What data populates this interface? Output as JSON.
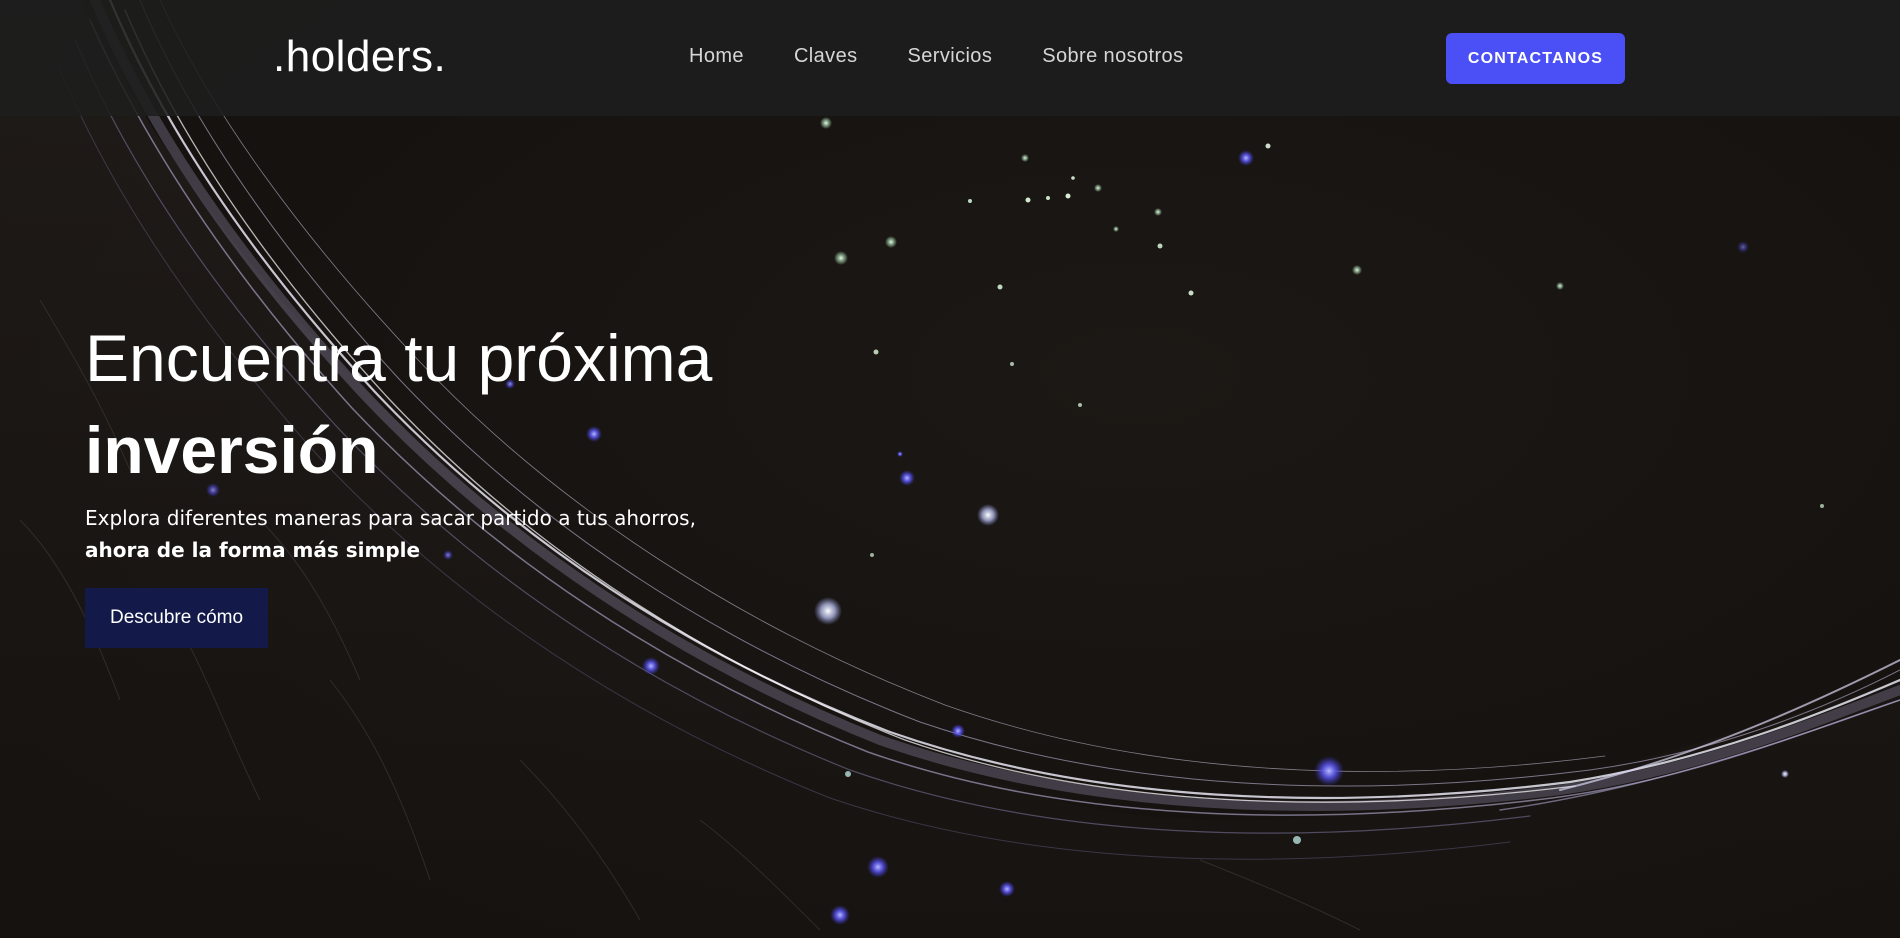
{
  "nav": {
    "logo": ".holders.",
    "links": [
      "Home",
      "Claves",
      "Servicios",
      "Sobre nosotros"
    ],
    "cta": "CONTACTANOS"
  },
  "hero": {
    "title_line1": "Encuentra tu próxima",
    "title_line2": "inversión",
    "subtitle_line1": "Explora diferentes maneras para sacar partido a tus ahorros,",
    "subtitle_line2": "ahora de la forma más simple",
    "button": "Descubre cómo"
  },
  "colors": {
    "accent": "#4a50f5",
    "button_dark": "#131a4a",
    "background": "#171311",
    "navbar": "#1e1e1e"
  }
}
